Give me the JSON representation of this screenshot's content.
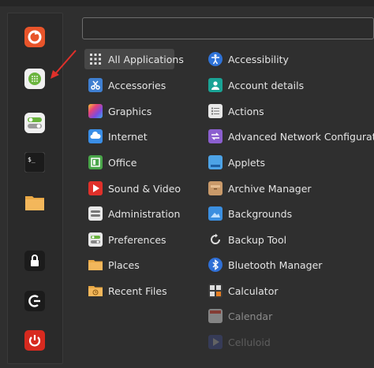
{
  "search": {
    "value": ""
  },
  "favorites": [
    {
      "name": "firefox",
      "icon": "firefox-icon",
      "color": "#e8542a"
    },
    {
      "name": "software-manager",
      "icon": "software-manager-icon",
      "color": "#f2f2f2"
    },
    {
      "name": "system-settings",
      "icon": "toggle-settings-icon",
      "color": "#f2f2f2"
    },
    {
      "name": "terminal",
      "icon": "terminal-icon",
      "color": "#1e1e1e"
    },
    {
      "name": "files",
      "icon": "folder-icon",
      "color": "#e9a845"
    },
    {
      "name": "lock-screen",
      "icon": "lock-icon",
      "color": "#1e1e1e"
    },
    {
      "name": "logout",
      "icon": "logout-icon",
      "color": "#1e1e1e"
    },
    {
      "name": "shutdown",
      "icon": "power-icon",
      "color": "#d72a1f"
    }
  ],
  "categories": [
    {
      "label": "All Applications",
      "icon": "grid-icon",
      "selected": true
    },
    {
      "label": "Accessories",
      "icon": "scissors-icon"
    },
    {
      "label": "Graphics",
      "icon": "graphics-icon"
    },
    {
      "label": "Internet",
      "icon": "cloud-icon"
    },
    {
      "label": "Office",
      "icon": "office-icon"
    },
    {
      "label": "Sound & Video",
      "icon": "play-icon"
    },
    {
      "label": "Administration",
      "icon": "admin-icon"
    },
    {
      "label": "Preferences",
      "icon": "preferences-icon"
    },
    {
      "label": "Places",
      "icon": "folder-icon"
    },
    {
      "label": "Recent Files",
      "icon": "recent-folder-icon"
    }
  ],
  "apps": [
    {
      "label": "Accessibility",
      "icon": "accessibility-icon"
    },
    {
      "label": "Account details",
      "icon": "account-icon"
    },
    {
      "label": "Actions",
      "icon": "actions-icon"
    },
    {
      "label": "Advanced Network Configuration",
      "icon": "network-config-icon"
    },
    {
      "label": "Applets",
      "icon": "applets-icon"
    },
    {
      "label": "Archive Manager",
      "icon": "archive-icon"
    },
    {
      "label": "Backgrounds",
      "icon": "backgrounds-icon"
    },
    {
      "label": "Backup Tool",
      "icon": "backup-icon"
    },
    {
      "label": "Bluetooth Manager",
      "icon": "bluetooth-icon"
    },
    {
      "label": "Calculator",
      "icon": "calculator-icon"
    },
    {
      "label": "Calendar",
      "icon": "calendar-icon"
    },
    {
      "label": "Celluloid",
      "icon": "celluloid-icon"
    }
  ]
}
